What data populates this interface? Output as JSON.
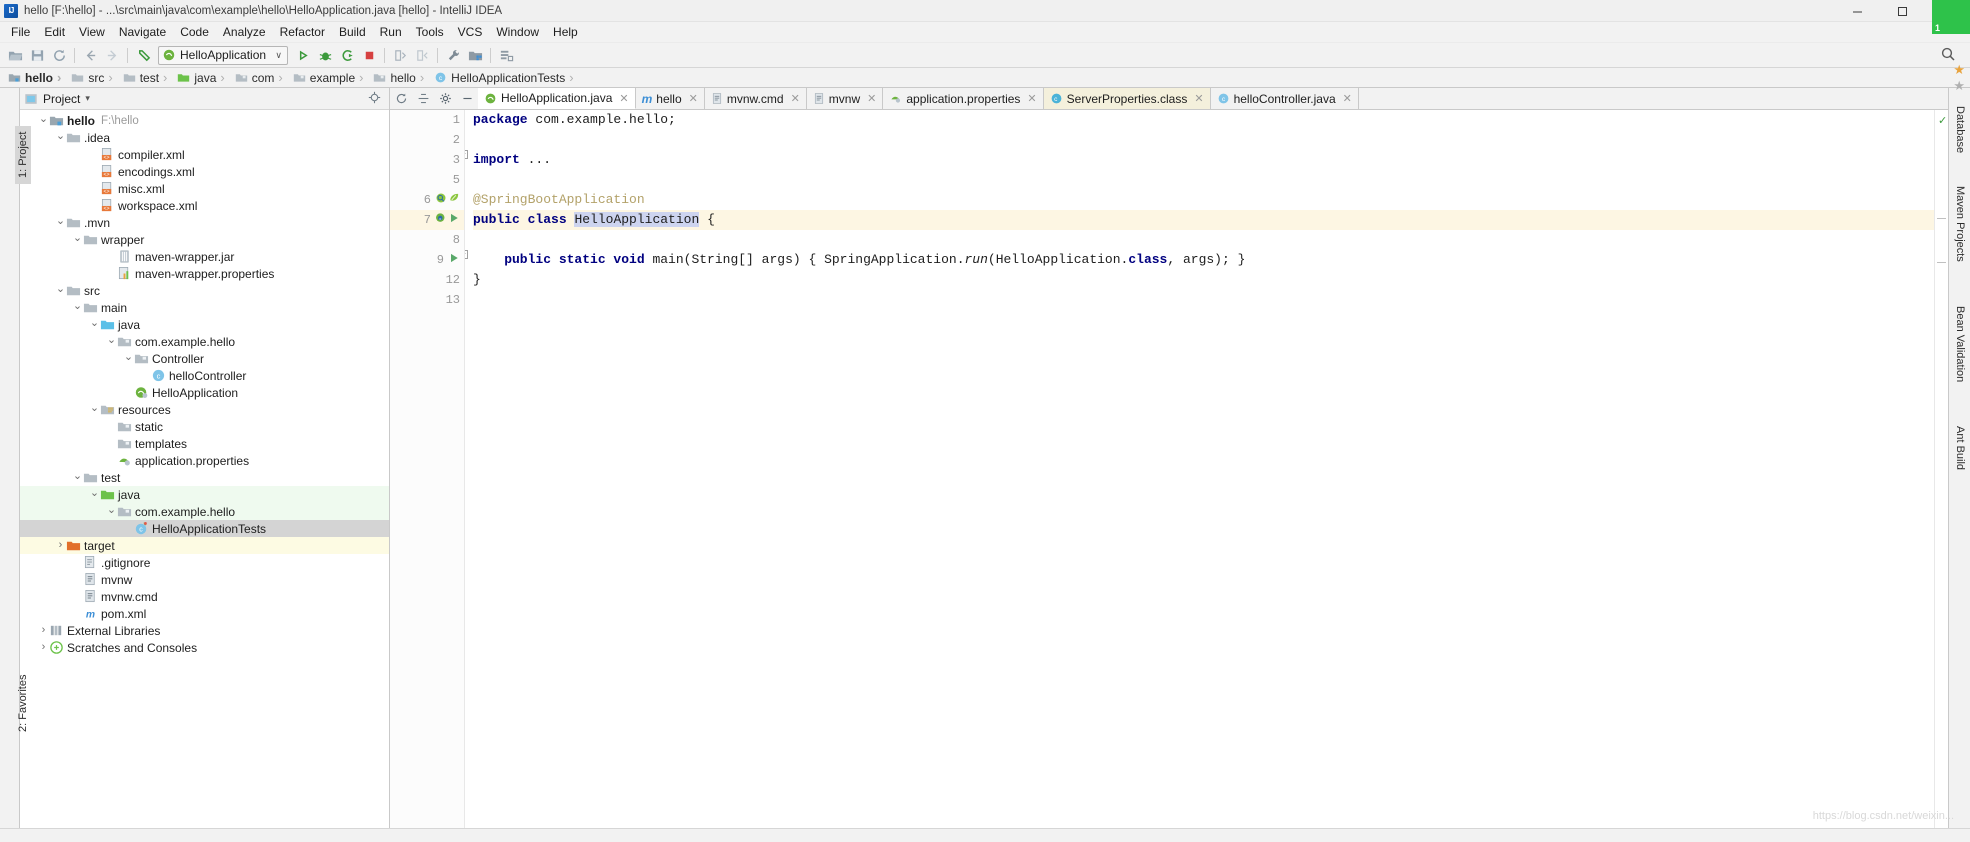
{
  "window": {
    "title": "hello [F:\\hello] - ...\\src\\main\\java\\com\\example\\hello\\HelloApplication.java [hello] - IntelliJ IDEA",
    "logo_text": "IJ",
    "buttons": [
      {
        "name": "minimize-button",
        "glyph": "─"
      },
      {
        "name": "maximize-button",
        "glyph": "☐"
      },
      {
        "name": "close-button",
        "glyph": "✕"
      }
    ]
  },
  "menubar": {
    "items": [
      {
        "label": "File"
      },
      {
        "label": "Edit"
      },
      {
        "label": "View"
      },
      {
        "label": "Navigate"
      },
      {
        "label": "Code"
      },
      {
        "label": "Analyze"
      },
      {
        "label": "Refactor"
      },
      {
        "label": "Build"
      },
      {
        "label": "Run"
      },
      {
        "label": "Tools"
      },
      {
        "label": "VCS"
      },
      {
        "label": "Window"
      },
      {
        "label": "Help"
      }
    ]
  },
  "toolbar": {
    "icons_left": [
      "open-folder-icon",
      "save-all-icon",
      "sync-refresh-icon"
    ],
    "nav_icons": [
      "back-arrow-icon",
      "forward-arrow-icon"
    ],
    "undo_icon": "undo-icon",
    "run_config": {
      "label": "HelloApplication",
      "icon": "spring-boot-run-config-icon",
      "chevron": "∨"
    },
    "run_icons": [
      "run-icon",
      "debug-icon",
      "run-coverage-icon",
      "stop-icon"
    ],
    "extra_icons": [
      "update-app-icon",
      "rerun-icon",
      "settings-wrench-icon",
      "project-structure-icon",
      "sdk-manager-icon"
    ],
    "search_icon": "search-icon"
  },
  "breadcrumb": {
    "items": [
      {
        "label": "hello",
        "icon": "module-folder-icon",
        "bold": true
      },
      {
        "label": "src",
        "icon": "folder-icon",
        "bold": false
      },
      {
        "label": "test",
        "icon": "folder-icon",
        "bold": false
      },
      {
        "label": "java",
        "icon": "source-root-folder-icon",
        "bold": false
      },
      {
        "label": "com",
        "icon": "package-folder-icon",
        "bold": false
      },
      {
        "label": "example",
        "icon": "package-folder-icon",
        "bold": false
      },
      {
        "label": "hello",
        "icon": "package-folder-icon",
        "bold": false
      },
      {
        "label": "HelloApplicationTests",
        "icon": "java-class-icon",
        "bold": false
      }
    ]
  },
  "left_strip": {
    "project_tab": "1: Project",
    "favorites_tab": "2: Favorites"
  },
  "right_strip": {
    "tabs": [
      "Database",
      "Maven Projects",
      "Bean Validation",
      "Ant Build"
    ]
  },
  "project_panel": {
    "title": "Project",
    "dropdown_chevron": "▾",
    "actions": [
      "target-locate-icon",
      "collapse-all-icon",
      "settings-gear-icon",
      "hide-panel-icon"
    ],
    "tree": [
      {
        "depth": 0,
        "arrow": "down",
        "icon": "module-folder-icon",
        "label": "hello",
        "bold": true,
        "path": "F:\\hello",
        "state": "normal"
      },
      {
        "depth": 1,
        "arrow": "down",
        "icon": "folder-icon",
        "label": ".idea",
        "bold": false,
        "path": "",
        "state": "normal"
      },
      {
        "depth": 3,
        "arrow": "none",
        "icon": "xml-file-icon",
        "label": "compiler.xml",
        "bold": false,
        "path": "",
        "state": "normal"
      },
      {
        "depth": 3,
        "arrow": "none",
        "icon": "xml-file-icon",
        "label": "encodings.xml",
        "bold": false,
        "path": "",
        "state": "normal"
      },
      {
        "depth": 3,
        "arrow": "none",
        "icon": "xml-file-icon",
        "label": "misc.xml",
        "bold": false,
        "path": "",
        "state": "normal"
      },
      {
        "depth": 3,
        "arrow": "none",
        "icon": "xml-file-icon",
        "label": "workspace.xml",
        "bold": false,
        "path": "",
        "state": "normal"
      },
      {
        "depth": 1,
        "arrow": "down",
        "icon": "folder-icon",
        "label": ".mvn",
        "bold": false,
        "path": "",
        "state": "normal"
      },
      {
        "depth": 2,
        "arrow": "down",
        "icon": "folder-icon",
        "label": "wrapper",
        "bold": false,
        "path": "",
        "state": "normal"
      },
      {
        "depth": 4,
        "arrow": "none",
        "icon": "jar-file-icon",
        "label": "maven-wrapper.jar",
        "bold": false,
        "path": "",
        "state": "normal"
      },
      {
        "depth": 4,
        "arrow": "none",
        "icon": "properties-file-icon",
        "label": "maven-wrapper.properties",
        "bold": false,
        "path": "",
        "state": "normal"
      },
      {
        "depth": 1,
        "arrow": "down",
        "icon": "folder-icon",
        "label": "src",
        "bold": false,
        "path": "",
        "state": "normal"
      },
      {
        "depth": 2,
        "arrow": "down",
        "icon": "folder-icon",
        "label": "main",
        "bold": false,
        "path": "",
        "state": "normal"
      },
      {
        "depth": 3,
        "arrow": "down",
        "icon": "source-root-folder-icon",
        "label": "java",
        "bold": false,
        "path": "",
        "state": "normal"
      },
      {
        "depth": 4,
        "arrow": "down",
        "icon": "package-folder-icon",
        "label": "com.example.hello",
        "bold": false,
        "path": "",
        "state": "normal"
      },
      {
        "depth": 5,
        "arrow": "down",
        "icon": "package-folder-icon",
        "label": "Controller",
        "bold": false,
        "path": "",
        "state": "normal"
      },
      {
        "depth": 6,
        "arrow": "none",
        "icon": "java-class-icon",
        "label": "helloController",
        "bold": false,
        "path": "",
        "state": "normal"
      },
      {
        "depth": 5,
        "arrow": "none",
        "icon": "spring-boot-class-icon",
        "label": "HelloApplication",
        "bold": false,
        "path": "",
        "state": "normal"
      },
      {
        "depth": 3,
        "arrow": "down",
        "icon": "resource-root-folder-icon",
        "label": "resources",
        "bold": false,
        "path": "",
        "state": "normal"
      },
      {
        "depth": 4,
        "arrow": "none",
        "icon": "package-folder-icon",
        "label": "static",
        "bold": false,
        "path": "",
        "state": "normal"
      },
      {
        "depth": 4,
        "arrow": "none",
        "icon": "package-folder-icon",
        "label": "templates",
        "bold": false,
        "path": "",
        "state": "normal"
      },
      {
        "depth": 4,
        "arrow": "none",
        "icon": "spring-properties-file-icon",
        "label": "application.properties",
        "bold": false,
        "path": "",
        "state": "normal"
      },
      {
        "depth": 2,
        "arrow": "down",
        "icon": "folder-icon",
        "label": "test",
        "bold": false,
        "path": "",
        "state": "normal"
      },
      {
        "depth": 3,
        "arrow": "down",
        "icon": "test-source-root-folder-icon",
        "label": "java",
        "bold": false,
        "path": "",
        "state": "green"
      },
      {
        "depth": 4,
        "arrow": "down",
        "icon": "package-folder-icon",
        "label": "com.example.hello",
        "bold": false,
        "path": "",
        "state": "green"
      },
      {
        "depth": 5,
        "arrow": "none",
        "icon": "java-test-class-icon",
        "label": "HelloApplicationTests",
        "bold": false,
        "path": "",
        "state": "selected"
      },
      {
        "depth": 1,
        "arrow": "right",
        "icon": "target-folder-icon",
        "label": "target",
        "bold": false,
        "path": "",
        "state": "yellow"
      },
      {
        "depth": 2,
        "arrow": "none",
        "icon": "gitignore-file-icon",
        "label": ".gitignore",
        "bold": false,
        "path": "",
        "state": "normal"
      },
      {
        "depth": 2,
        "arrow": "none",
        "icon": "text-file-icon",
        "label": "mvnw",
        "bold": false,
        "path": "",
        "state": "normal"
      },
      {
        "depth": 2,
        "arrow": "none",
        "icon": "text-file-icon",
        "label": "mvnw.cmd",
        "bold": false,
        "path": "",
        "state": "normal"
      },
      {
        "depth": 2,
        "arrow": "none",
        "icon": "maven-pom-icon",
        "label": "pom.xml",
        "bold": false,
        "path": "",
        "state": "normal"
      },
      {
        "depth": 0,
        "arrow": "right",
        "icon": "external-libraries-icon",
        "label": "External Libraries",
        "bold": false,
        "path": "",
        "state": "normal"
      },
      {
        "depth": 0,
        "arrow": "right",
        "icon": "scratches-icon",
        "label": "Scratches and Consoles",
        "bold": false,
        "path": "",
        "state": "normal"
      }
    ]
  },
  "editor": {
    "tab_controls": [
      "restore-layout-icon",
      "split-icon",
      "settings-gear-icon",
      "hide-icon"
    ],
    "tabs": [
      {
        "label": "HelloApplication.java",
        "icon": "spring-boot-class-icon",
        "active": true,
        "highlight": false,
        "close": "✕"
      },
      {
        "label": "hello",
        "icon": "maven-module-icon",
        "active": false,
        "highlight": false,
        "close": "✕"
      },
      {
        "label": "mvnw.cmd",
        "icon": "text-file-icon",
        "active": false,
        "highlight": false,
        "close": "✕"
      },
      {
        "label": "mvnw",
        "icon": "text-file-icon",
        "active": false,
        "highlight": false,
        "close": "✕"
      },
      {
        "label": "application.properties",
        "icon": "spring-properties-file-icon",
        "active": false,
        "highlight": false,
        "close": "✕"
      },
      {
        "label": "ServerProperties.class",
        "icon": "java-class-file-icon",
        "active": false,
        "highlight": true,
        "close": "✕"
      },
      {
        "label": "helloController.java",
        "icon": "java-class-icon",
        "active": false,
        "highlight": false,
        "close": "✕"
      }
    ],
    "gutter_lines": [
      "1",
      "2",
      "3",
      "5",
      "6",
      "7",
      "8",
      "9",
      "12",
      "13"
    ],
    "code_lines": [
      {
        "num": "1",
        "highlight": false,
        "fold": false,
        "tokens": [
          {
            "t": "package",
            "c": "kw"
          },
          {
            "t": " com.example.hello;",
            "c": "plain"
          }
        ]
      },
      {
        "num": "2",
        "highlight": false,
        "fold": false,
        "tokens": []
      },
      {
        "num": "3",
        "highlight": false,
        "fold": true,
        "tokens": [
          {
            "t": "import",
            "c": "kw"
          },
          {
            "t": " ",
            "c": "plain"
          },
          {
            "t": "...",
            "c": "plain"
          }
        ]
      },
      {
        "num": "5",
        "highlight": false,
        "fold": false,
        "tokens": []
      },
      {
        "num": "6",
        "highlight": false,
        "fold": false,
        "tokens": [
          {
            "t": "@SpringBootApplication",
            "c": "anno"
          }
        ]
      },
      {
        "num": "7",
        "highlight": true,
        "fold": false,
        "tokens": [
          {
            "t": "public class",
            "c": "kw"
          },
          {
            "t": " ",
            "c": "plain"
          },
          {
            "t": "HelloApplication",
            "c": "selbg"
          },
          {
            "t": " {",
            "c": "plain"
          }
        ]
      },
      {
        "num": "8",
        "highlight": false,
        "fold": false,
        "tokens": []
      },
      {
        "num": "9",
        "highlight": false,
        "fold": true,
        "tokens": [
          {
            "t": "    public static void",
            "c": "kw"
          },
          {
            "t": " main(String[] args) { SpringApplication.",
            "c": "plain"
          },
          {
            "t": "run",
            "c": "ital"
          },
          {
            "t": "(HelloApplication.",
            "c": "plain"
          },
          {
            "t": "class",
            "c": "kw"
          },
          {
            "t": ", args); }",
            "c": "plain"
          }
        ]
      },
      {
        "num": "12",
        "highlight": false,
        "fold": false,
        "tokens": [
          {
            "t": "}",
            "c": "plain"
          }
        ]
      },
      {
        "num": "13",
        "highlight": false,
        "fold": false,
        "tokens": []
      }
    ],
    "gutter_markers": [
      {
        "line_index": 4,
        "icons": [
          "spring-bean-icon",
          "spring-leaf-icon"
        ]
      },
      {
        "line_index": 5,
        "icons": [
          "spring-boot-gutter-icon",
          "run-green-triangle-icon"
        ]
      },
      {
        "line_index": 7,
        "icons": [
          "run-green-triangle-icon"
        ]
      }
    ],
    "rail": {
      "status_icon": "✓"
    }
  },
  "watermark": "https://blog.csdn.net/weixin...",
  "colors": {
    "accent_green": "#2ec24a",
    "selection": "#cdd4ef",
    "line_highlight": "#fdf6e3",
    "test_green": "#effaef",
    "tree_selected": "#d4d4d4",
    "keyword": "#000080",
    "annotation": "#b3a26a"
  },
  "corner": {
    "badge_number": "1"
  }
}
